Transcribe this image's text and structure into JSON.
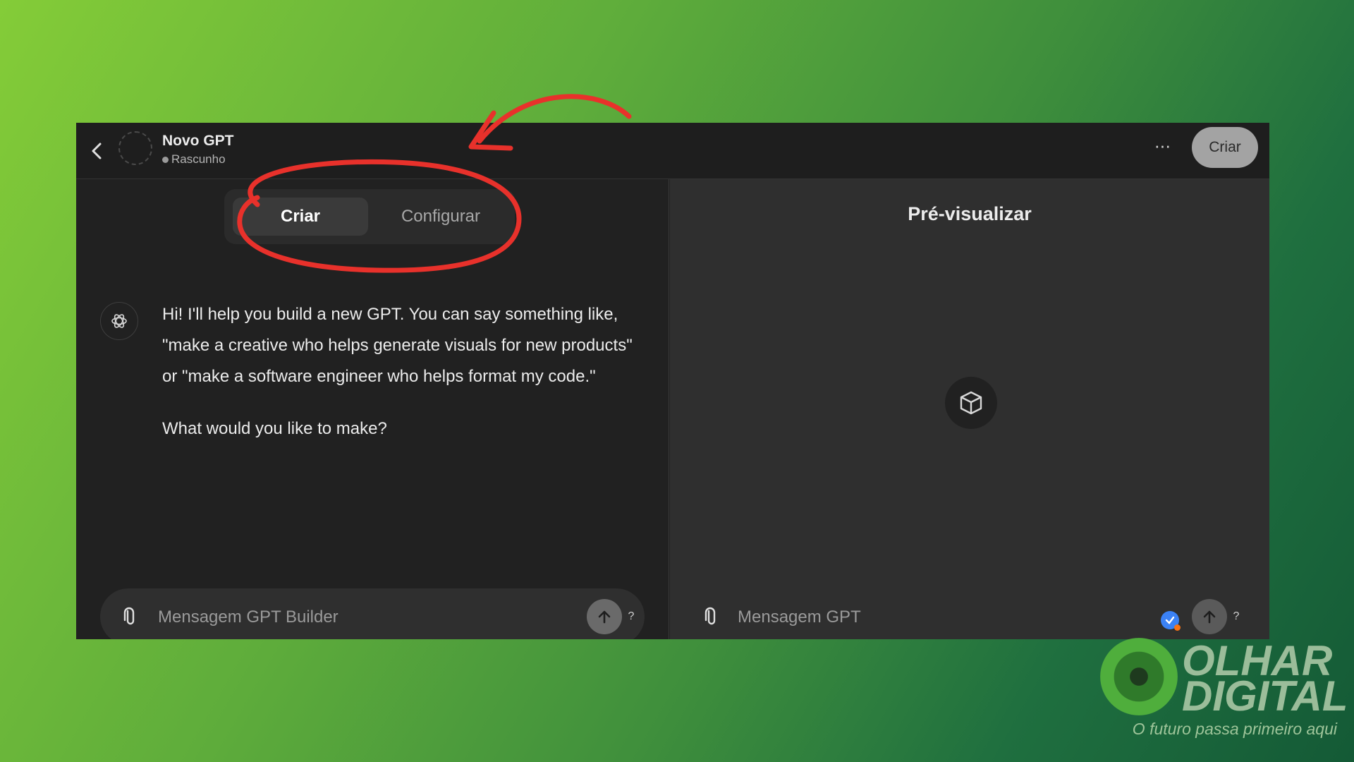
{
  "header": {
    "title": "Novo GPT",
    "status": "Rascunho",
    "more_label": "···",
    "create_label": "Criar"
  },
  "tabs": [
    {
      "label": "Criar",
      "active": true
    },
    {
      "label": "Configurar",
      "active": false
    }
  ],
  "chat": {
    "messages": [
      "Hi! I'll help you build a new GPT. You can say something like, \"make a creative who helps generate visuals for new products\" or \"make a software engineer who helps format my code.\"",
      "What would you like to make?"
    ],
    "input_placeholder": "Mensagem GPT Builder",
    "help_label": "?"
  },
  "preview": {
    "title": "Pré-visualizar",
    "input_placeholder": "Mensagem GPT",
    "help_label": "?"
  },
  "branding": {
    "logo_line1": "OLHAR",
    "logo_line2": "DIGITAL",
    "tagline": "O futuro passa primeiro aqui"
  },
  "colors": {
    "annotation": "#e8312b",
    "window_bg": "#212121",
    "preview_bg": "#2f2f2f"
  },
  "icons": [
    "back-arrow-icon",
    "openai-logo-icon",
    "cube-icon",
    "paperclip-icon",
    "send-arrow-icon",
    "verified-badge-icon"
  ]
}
